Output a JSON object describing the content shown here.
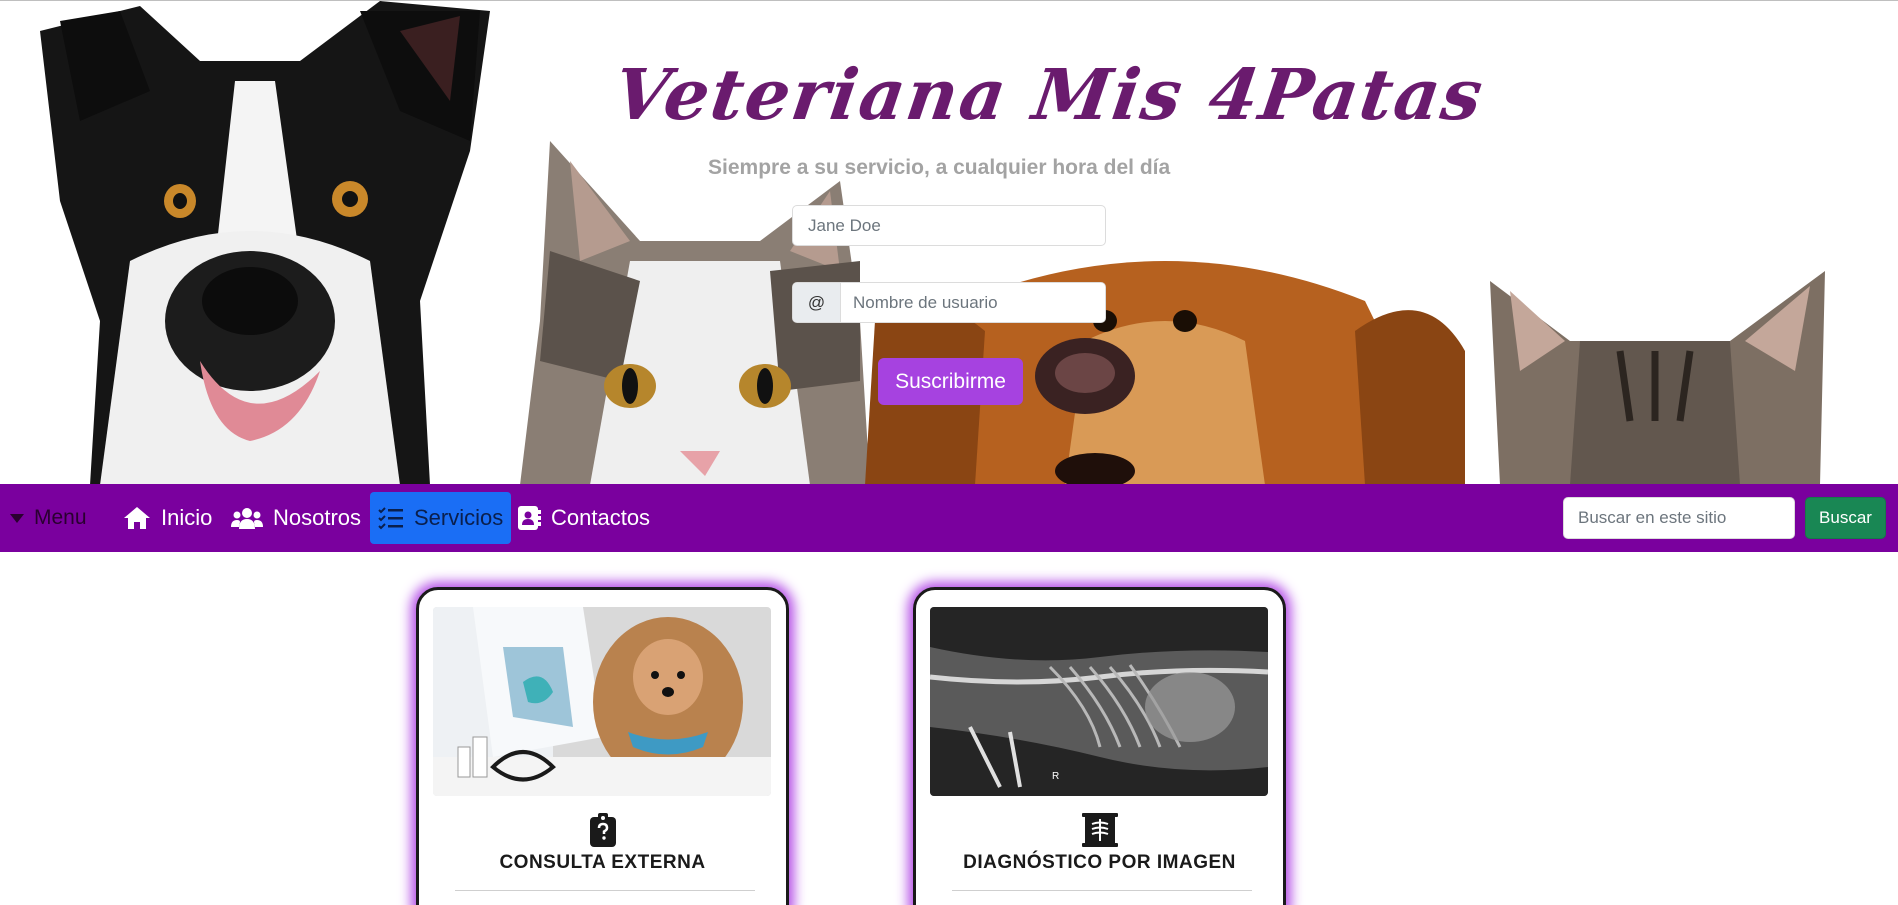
{
  "hero": {
    "title": "Veteriana  Mis  4Patas",
    "tagline": "Siempre a su servicio, a cualquier hora del día",
    "name_placeholder": "Jane Doe",
    "username_addon": "@",
    "username_placeholder": "Nombre de usuario",
    "subscribe_label": "Suscribirme"
  },
  "navbar": {
    "menu_label": "Menu",
    "items": [
      {
        "label": "Inicio",
        "icon": "house-icon"
      },
      {
        "label": "Nosotros",
        "icon": "users-icon"
      },
      {
        "label": "Servicios",
        "icon": "list-check-icon",
        "active": true
      },
      {
        "label": "Contactos",
        "icon": "address-book-icon"
      }
    ],
    "search_placeholder": "Buscar en este sitio",
    "search_button": "Buscar"
  },
  "cards": [
    {
      "title": "CONSULTA EXTERNA",
      "icon": "clipboard-question-icon",
      "image": "vet-consultation-photo"
    },
    {
      "title": "DIAGNÓSTICO POR IMAGEN",
      "icon": "x-ray-icon",
      "image": "x-ray-photo"
    }
  ],
  "colors": {
    "navbar": "#7a009e",
    "active_tab": "#1a6ef5",
    "subscribe": "#a642e0",
    "search_button": "#198754",
    "title": "#6a1b6e",
    "card_glow": "#b44ee6"
  }
}
